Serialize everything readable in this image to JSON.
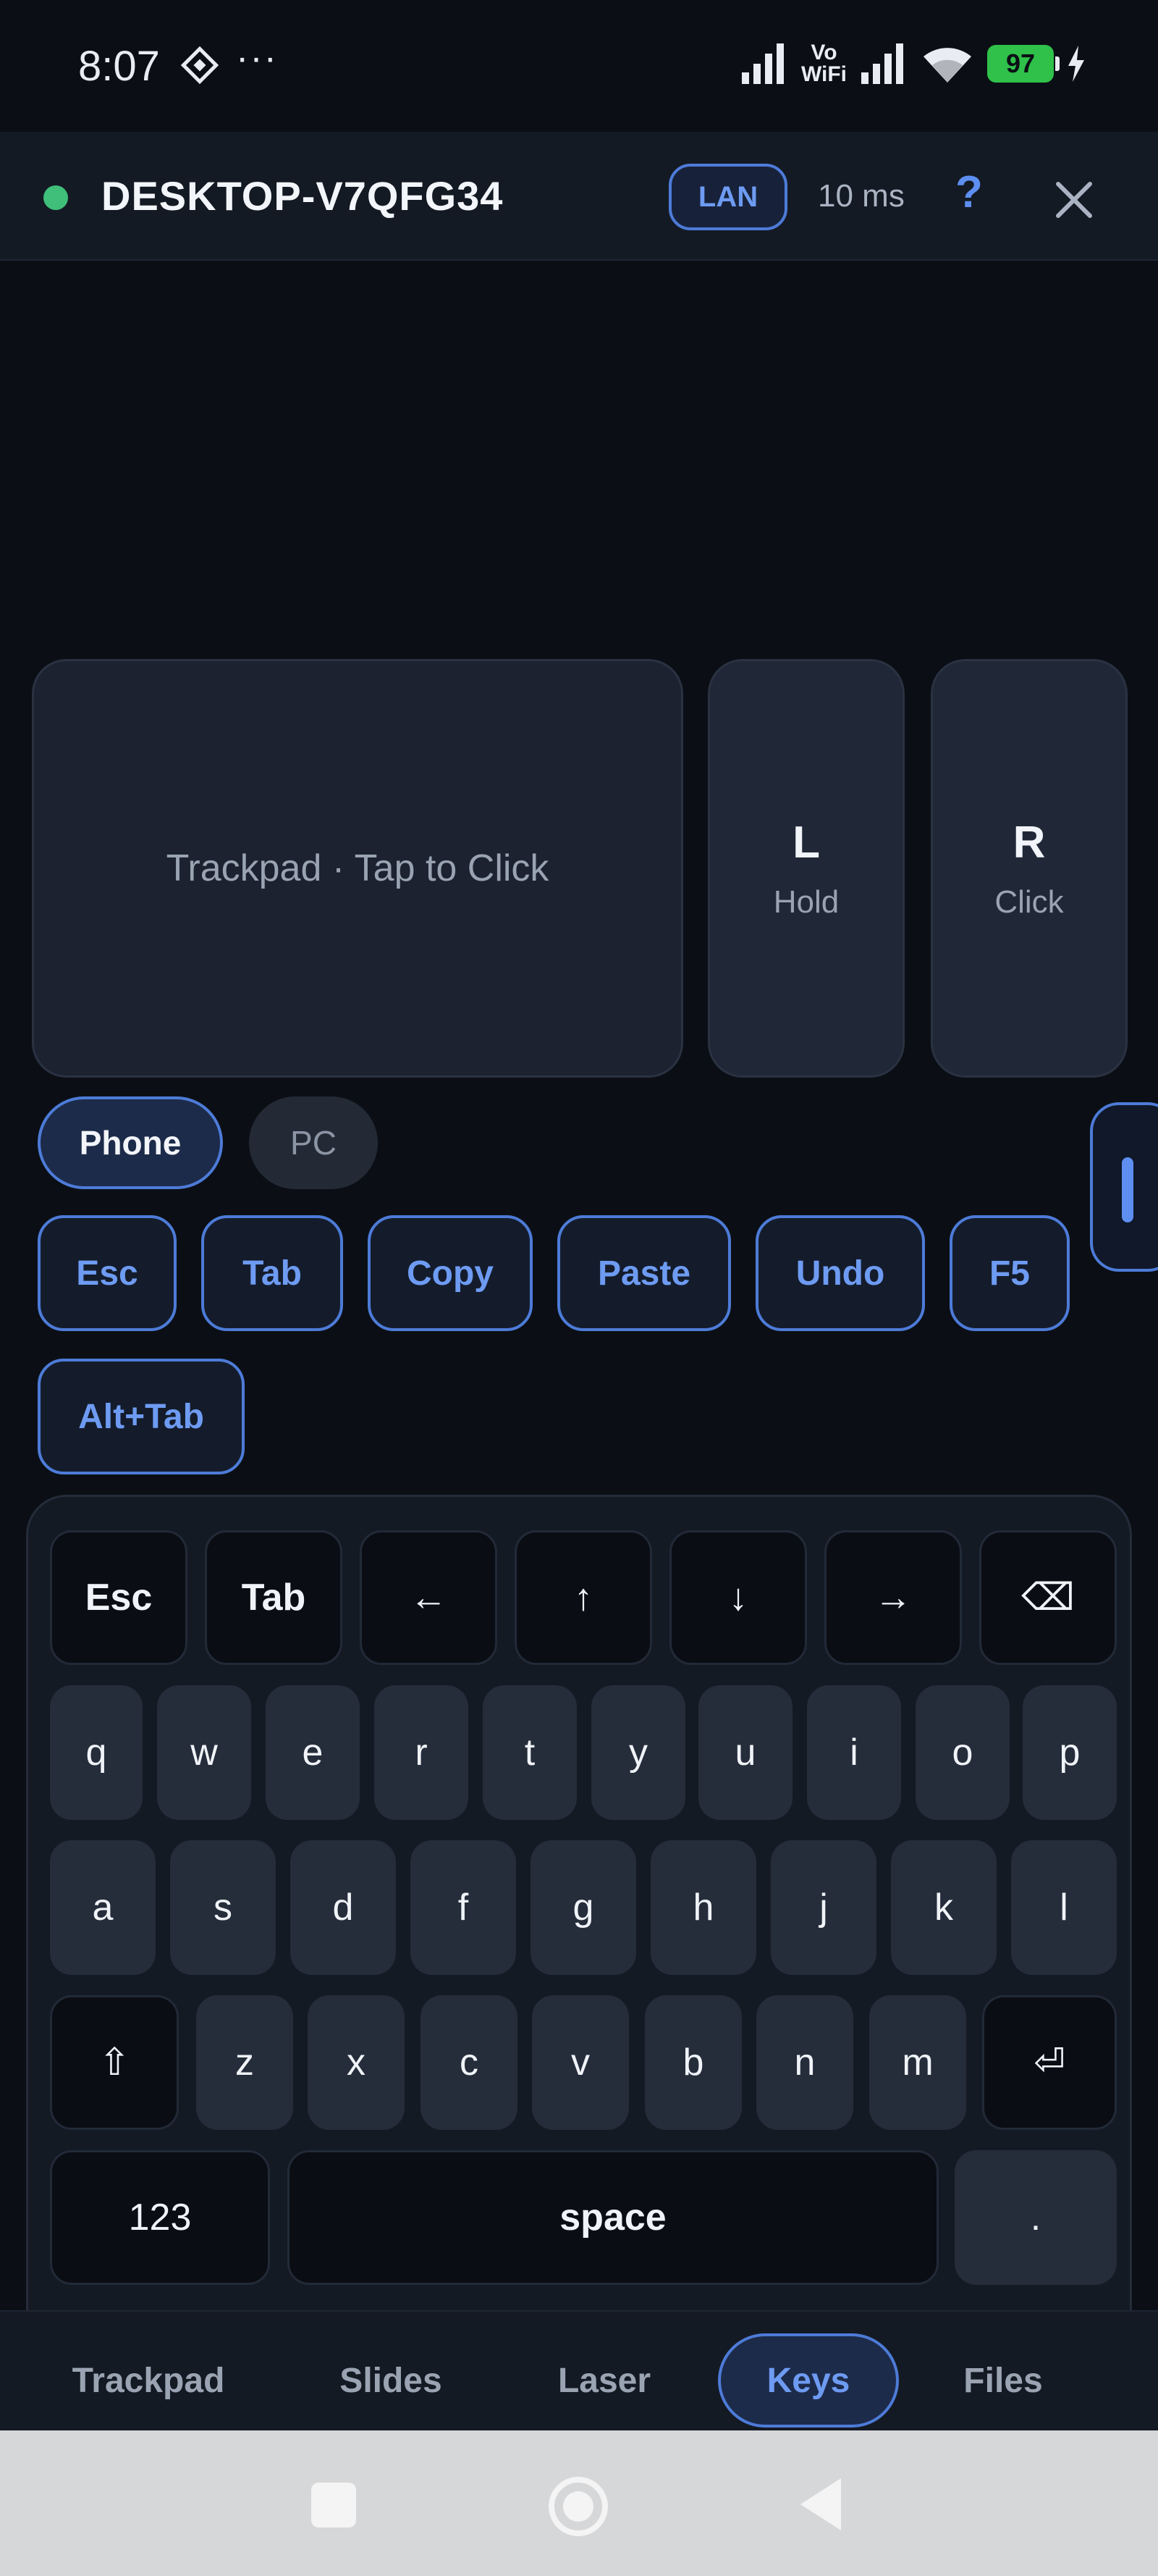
{
  "status_bar": {
    "time": "8:07",
    "dots": "···",
    "vowifi_top": "Vo",
    "vowifi_bottom": "WiFi",
    "battery": "97",
    "icons": [
      "app-notification-icon",
      "signal-icon",
      "vowifi-icon",
      "wifi-icon",
      "battery-icon",
      "charging-icon"
    ]
  },
  "header": {
    "host_name": "DESKTOP-V7QFG34",
    "connection_badge": "LAN",
    "latency": "10 ms",
    "help_label": "?",
    "status_color": "#3fbf7a"
  },
  "trackpad": {
    "label": "Trackpad · Tap to Click",
    "left_button": {
      "label": "L",
      "sub": "Hold"
    },
    "right_button": {
      "label": "R",
      "sub": "Click"
    }
  },
  "mode_toggle": {
    "options": [
      "Phone",
      "PC"
    ],
    "selected": "Phone"
  },
  "shortcuts": [
    "Esc",
    "Tab",
    "Copy",
    "Paste",
    "Undo",
    "F5",
    "Alt+Tab"
  ],
  "keyboard": {
    "nav_row": [
      "Esc",
      "Tab",
      "←",
      "↑",
      "↓",
      "→",
      "⌫"
    ],
    "row1": [
      "q",
      "w",
      "e",
      "r",
      "t",
      "y",
      "u",
      "i",
      "o",
      "p"
    ],
    "row2": [
      "a",
      "s",
      "d",
      "f",
      "g",
      "h",
      "j",
      "k",
      "l"
    ],
    "row3": [
      "⇧",
      "z",
      "x",
      "c",
      "v",
      "b",
      "n",
      "m",
      "⏎"
    ],
    "row4": [
      "123",
      "space",
      "."
    ]
  },
  "tabs": [
    "Trackpad",
    "Slides",
    "Laser",
    "Keys",
    "Files"
  ],
  "active_tab": "Keys",
  "colors": {
    "accent": "#4d7bd8",
    "accent_text": "#6e9bf2",
    "background": "#0b0f15",
    "battery": "#2fc14a"
  }
}
